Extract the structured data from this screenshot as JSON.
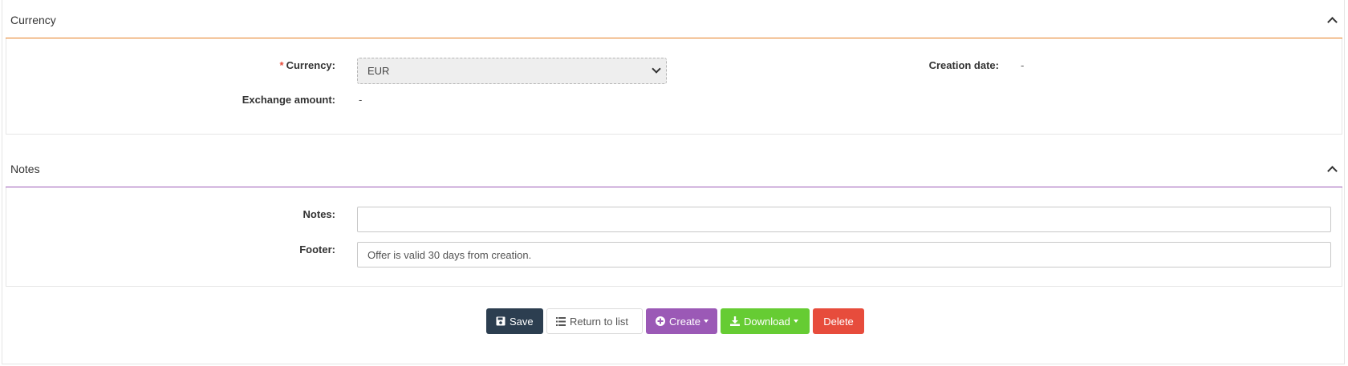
{
  "currency_panel": {
    "title": "Currency",
    "accent_color": "#e67e22",
    "currency_label": "Currency:",
    "currency_value": "EUR",
    "currency_options": [
      "EUR"
    ],
    "exchange_label": "Exchange amount:",
    "exchange_value": "-",
    "creation_label": "Creation date:",
    "creation_value": "-"
  },
  "notes_panel": {
    "title": "Notes",
    "accent_color": "#9b59b6",
    "notes_label": "Notes:",
    "notes_value": "",
    "footer_label": "Footer:",
    "footer_value": "Offer is valid 30 days from creation."
  },
  "actions": {
    "save": "Save",
    "return_to_list": "Return to list",
    "create": "Create",
    "download": "Download",
    "delete": "Delete"
  },
  "icons": {
    "collapse": "chevron-up-icon",
    "save": "floppy-disk-icon",
    "list": "list-icon",
    "create": "plus-circle-icon",
    "download": "download-icon"
  }
}
